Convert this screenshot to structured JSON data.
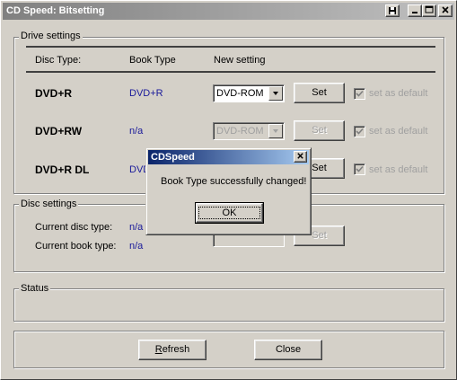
{
  "window": {
    "title": "CD Speed: Bitsetting",
    "controls": [
      "save-icon",
      "minimize-icon",
      "maximize-icon",
      "close-icon"
    ]
  },
  "drive_settings": {
    "legend": "Drive settings",
    "headers": {
      "disc_type": "Disc Type:",
      "book_type": "Book Type",
      "new_setting": "New setting"
    },
    "rows": [
      {
        "disc": "DVD+R",
        "book": "DVD+R",
        "setting": "DVD-ROM",
        "set_label": "Set",
        "default_label": "set as default",
        "enabled": true
      },
      {
        "disc": "DVD+RW",
        "book": "n/a",
        "setting": "DVD-ROM",
        "set_label": "Set",
        "default_label": "set as default",
        "enabled": false
      },
      {
        "disc": "DVD+R DL",
        "book": "DVD",
        "setting": "",
        "set_label": "Set",
        "default_label": "set as default",
        "enabled": true
      }
    ]
  },
  "disc_settings": {
    "legend": "Disc settings",
    "current_disc_label": "Current disc type:",
    "current_disc_value": "n/a",
    "current_book_label": "Current book type:",
    "current_book_value": "n/a",
    "set_label": "Set"
  },
  "status": {
    "legend": "Status"
  },
  "footer": {
    "refresh_label": "Refresh",
    "close_label": "Close"
  },
  "dialog": {
    "title": "CDSpeed",
    "message": "Book Type successfully changed!",
    "ok_label": "OK"
  }
}
